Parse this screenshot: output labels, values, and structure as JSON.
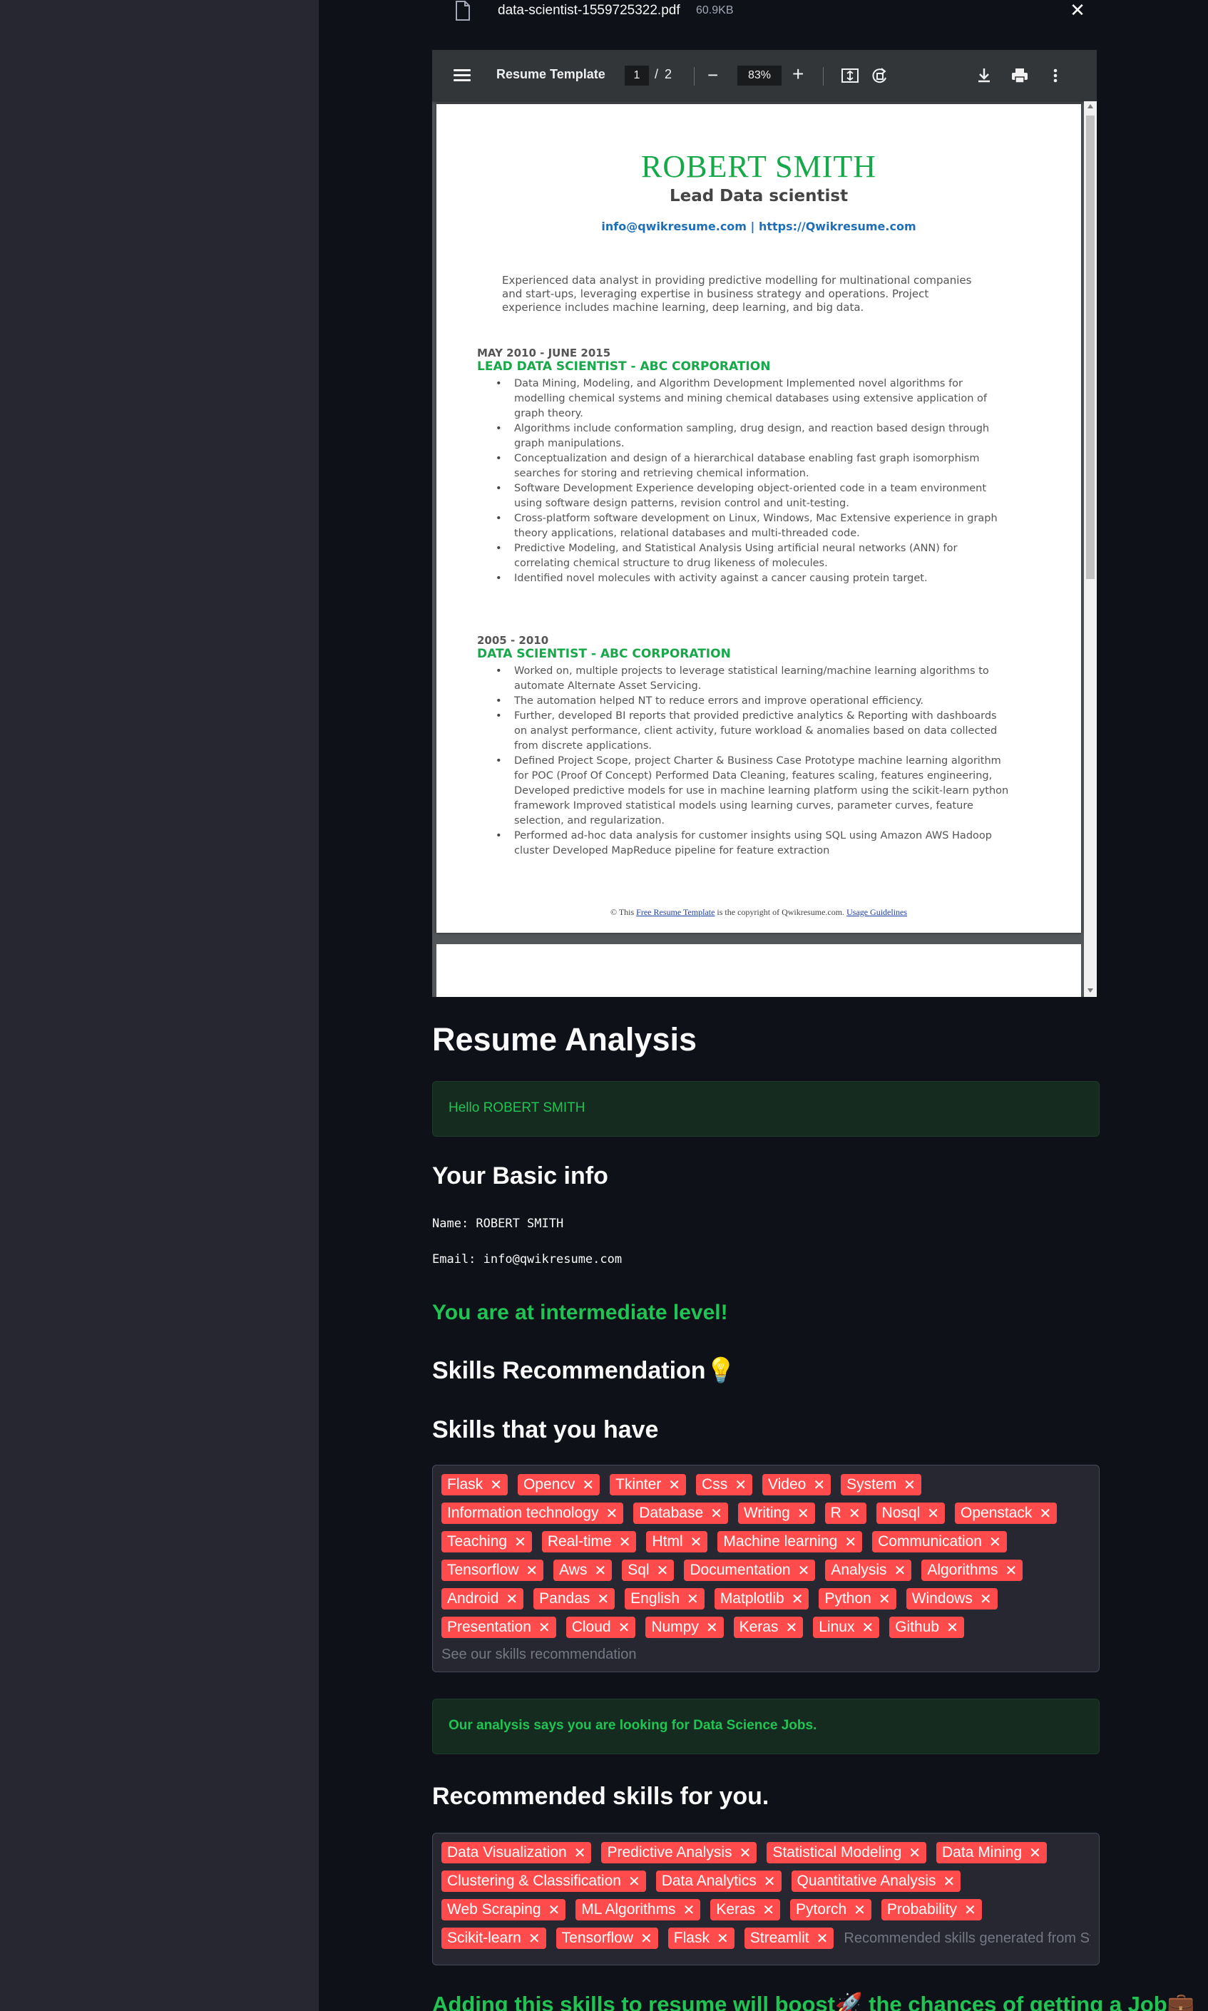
{
  "uploader": {
    "file_name": "data-scientist-1559725322.pdf",
    "file_size": "60.9KB",
    "close_label": "✕"
  },
  "pdf_viewer": {
    "title": "Resume Template",
    "current_page": "1",
    "page_separator": "/",
    "total_pages": "2",
    "zoom": "83%",
    "zoom_out": "−",
    "zoom_in": "+"
  },
  "resume": {
    "name": "ROBERT SMITH",
    "role": "Lead Data scientist",
    "contact": "info@qwikresume.com | https://Qwikresume.com",
    "summary": "Experienced data analyst in providing predictive modelling for multinational companies and start-ups, leveraging expertise in business strategy and operations. Project experience includes machine learning, deep learning, and big data.",
    "jobs": [
      {
        "dates": "MAY 2010 - JUNE 2015",
        "title": "LEAD DATA SCIENTIST - ABC CORPORATION",
        "bullets": [
          "Data Mining, Modeling, and Algorithm Development Implemented novel algorithms for modelling chemical systems and mining chemical databases using extensive application of graph theory.",
          "Algorithms include conformation sampling, drug design, and reaction based design through graph manipulations.",
          "Conceptualization and design of a hierarchical database enabling fast graph isomorphism searches for storing and retrieving chemical information.",
          "Software Development Experience developing object-oriented code in a team environment using software design patterns, revision control and unit-testing.",
          "Cross-platform software development on Linux, Windows, Mac Extensive experience in graph theory applications, relational databases and multi-threaded code.",
          "Predictive Modeling, and Statistical Analysis Using artificial neural networks (ANN) for correlating chemical structure to drug likeness of molecules.",
          "Identified novel molecules with activity against a cancer causing protein target."
        ]
      },
      {
        "dates": "2005 - 2010",
        "title": "DATA SCIENTIST - ABC CORPORATION",
        "bullets": [
          "Worked on, multiple projects to leverage statistical learning/machine learning algorithms to automate Alternate Asset Servicing.",
          "The automation helped NT to reduce errors and improve operational efficiency.",
          "Further, developed BI reports that provided predictive analytics & Reporting with dashboards on analyst performance, client activity, future workload & anomalies based on data collected from discrete applications.",
          "Defined Project Scope, project Charter & Business Case Prototype machine learning algorithm for POC (Proof Of Concept) Performed Data Cleaning, features scaling, features engineering, Developed predictive models for use in machine learning platform using the scikit-learn python framework Improved statistical models using learning curves, parameter curves, feature selection, and regularization.",
          "Performed ad-hoc data analysis for customer insights using SQL using Amazon AWS Hadoop cluster Developed MapReduce pipeline for feature extraction"
        ]
      }
    ],
    "footer_prefix": "© This ",
    "footer_link1": "Free Resume Template",
    "footer_middle": " is the copyright of Qwikresume.com. ",
    "footer_link2": "Usage Guidelines"
  },
  "analysis": {
    "heading": "Resume Analysis",
    "hello": "Hello ROBERT SMITH",
    "basic_info_heading": "Your Basic info",
    "name_line": "Name: ROBERT SMITH",
    "email_line": "Email: info@qwikresume.com",
    "level": "You are at intermediate level!",
    "skills_reco_heading": "Skills Recommendation💡",
    "skills_have_heading": "Skills that you have",
    "skills_have": [
      "Flask",
      "Opencv",
      "Tkinter",
      "Css",
      "Video",
      "System",
      "Information technology",
      "Database",
      "Writing",
      "R",
      "Nosql",
      "Openstack",
      "Teaching",
      "Real-time",
      "Html",
      "Machine learning",
      "Communication",
      "Tensorflow",
      "Aws",
      "Sql",
      "Documentation",
      "Analysis",
      "Algorithms",
      "Android",
      "Pandas",
      "English",
      "Matplotlib",
      "Python",
      "Windows",
      "Presentation",
      "Cloud",
      "Numpy",
      "Keras",
      "Linux",
      "Github"
    ],
    "skills_have_placeholder": "See our skills recommendation",
    "jobs_message": "Our analysis says you are looking for Data Science Jobs.",
    "recommended_heading": "Recommended skills for you.",
    "recommended": [
      "Data Visualization",
      "Predictive Analysis",
      "Statistical Modeling",
      "Data Mining",
      "Clustering & Classification",
      "Data Analytics",
      "Quantitative Analysis",
      "Web Scraping",
      "ML Algorithms",
      "Keras",
      "Pytorch",
      "Probability",
      "Scikit-learn",
      "Tensorflow",
      "Flask",
      "Streamlit"
    ],
    "recommended_placeholder": "Recommended skills generated from System",
    "boost_message": "Adding this skills to resume will boost🚀 the chances of getting a Job💼"
  },
  "colors": {
    "background": "#0e1117",
    "sidebar": "#262730",
    "chip": "#ff4b4b",
    "success": "#21c354",
    "resume_green": "#17a84a",
    "link_blue": "#1e6fb8"
  }
}
